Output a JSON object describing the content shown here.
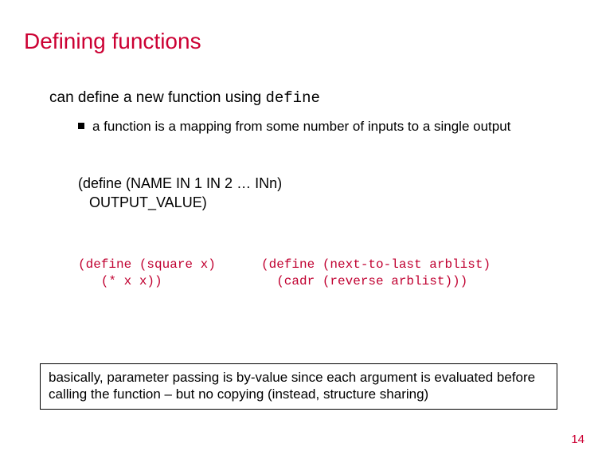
{
  "title": "Defining functions",
  "intro": {
    "text": "can define a new function using ",
    "code": "define"
  },
  "bullet": "a function is a mapping from some number of inputs to a single output",
  "template": {
    "line1": "(define (NAME IN 1 IN 2 … INn)",
    "line2": "OUTPUT_VALUE)"
  },
  "code_left": "(define (square x)\n   (* x x))",
  "code_right": "(define (next-to-last arblist)\n  (cadr (reverse arblist)))",
  "note": "basically, parameter passing is by-value since each argument is evaluated before calling the function – but no copying (instead, structure sharing)",
  "page_number": "14"
}
